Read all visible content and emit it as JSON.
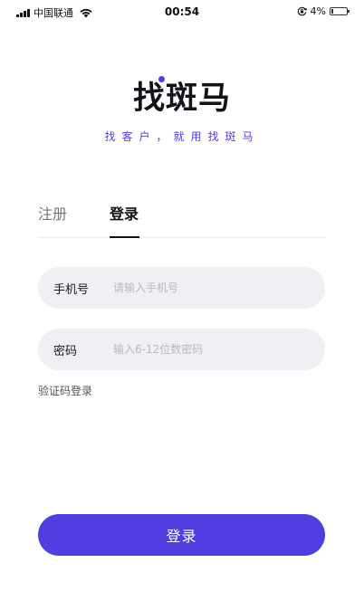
{
  "status_bar": {
    "carrier": "中国联通",
    "time": "00:54",
    "battery": "4%",
    "icons": [
      "signal-icon",
      "wifi-icon",
      "orientation-lock-icon",
      "battery-icon"
    ]
  },
  "brand": {
    "logo_text": "找斑马",
    "slogan": "找客户，就用找斑马",
    "accent_color": "#4f3fe0"
  },
  "tabs": [
    {
      "label": "注册",
      "active": false
    },
    {
      "label": "登录",
      "active": true
    }
  ],
  "form": {
    "phone": {
      "label": "手机号",
      "placeholder": "请输入手机号",
      "value": ""
    },
    "password": {
      "label": "密码",
      "placeholder": "输入6-12位数密码",
      "value": ""
    },
    "sms_login_link": "验证码登录",
    "submit_label": "登录"
  }
}
